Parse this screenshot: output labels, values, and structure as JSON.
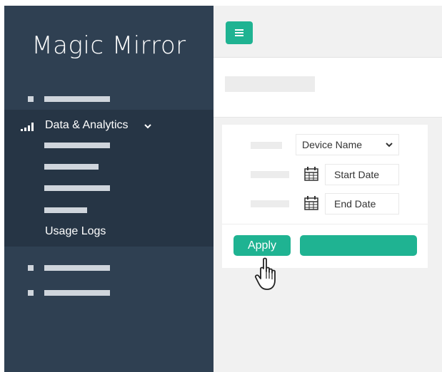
{
  "sidebar": {
    "logo": "Magic Mirror",
    "section": {
      "title": "Data & Analytics",
      "active_item": "Usage Logs"
    }
  },
  "form": {
    "device_select": "Device Name",
    "start_date_placeholder": "Start Date",
    "end_date_placeholder": "End Date",
    "apply_label": "Apply"
  },
  "icons": {
    "menu": "hamburger-icon",
    "section": "signal-bars-icon",
    "expand": "chevron-down-icon",
    "date": "calendar-icon",
    "pointer": "hand-cursor-icon"
  },
  "colors": {
    "accent": "#1fb392",
    "sidebar": "#2f4052",
    "sidebar_section": "#263545",
    "content_bg": "#f1f1f1"
  }
}
